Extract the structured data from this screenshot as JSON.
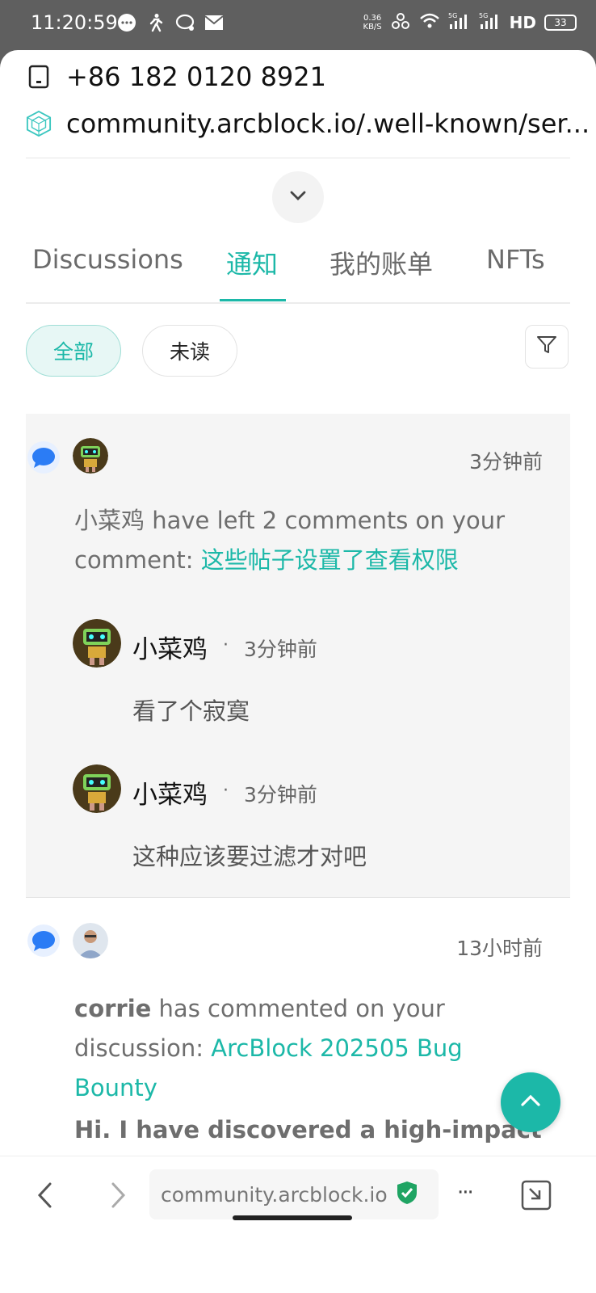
{
  "status_bar": {
    "time": "11:20:59",
    "speed_value": "0.36",
    "speed_unit": "KB/S",
    "battery": "33",
    "network_label": "HD"
  },
  "header": {
    "phone": "+86 182 0120 8921",
    "url_full": "community.arcblock.io/.well-known/ser..."
  },
  "tabs": [
    {
      "label": "Discussions"
    },
    {
      "label": "通知"
    },
    {
      "label": "我的账单"
    },
    {
      "label": "NFTs"
    }
  ],
  "filters": {
    "all_label": "全部",
    "unread_label": "未读"
  },
  "notifications": [
    {
      "time": "3分钟前",
      "message_prefix": "小菜鸡 have left 2 comments on your comment: ",
      "message_link": "这些帖子设置了查看权限",
      "comments": [
        {
          "author": "小菜鸡",
          "dot": "·",
          "time": "3分钟前",
          "text": "看了个寂寞"
        },
        {
          "author": "小菜鸡",
          "dot": "·",
          "time": "3分钟前",
          "text": "这种应该要过滤才对吧"
        }
      ]
    },
    {
      "time": "13小时前",
      "author": "corrie",
      "message_suffix": " has commented on your discussion: ",
      "message_link": "ArcBlock 202505 Bug Bounty",
      "preview": "Hi. I have discovered a high-impact"
    }
  ],
  "bottom_bar": {
    "url": "community.arcblock.io",
    "more_label": "···"
  },
  "colors": {
    "accent": "#1cb8a8",
    "bubble_blue": "#2b7cf5"
  }
}
